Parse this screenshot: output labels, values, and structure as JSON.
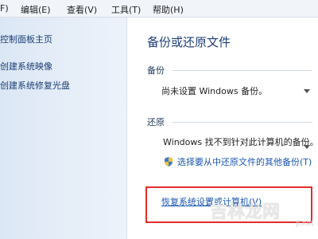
{
  "menubar": {
    "items": [
      "F)",
      "编辑(E)",
      "查看(V)",
      "工具(T)",
      "帮助(H)"
    ]
  },
  "sidebar": {
    "items": [
      "控制面板主页",
      "创建系统映像",
      "创建系统修复光盘"
    ]
  },
  "main": {
    "title": "备份或还原文件",
    "backup": {
      "heading": "备份",
      "status": "尚未设置 Windows 备份。"
    },
    "restore": {
      "heading": "还原",
      "status": "Windows 找不到针对此计算机的备份。",
      "other_link": "选择要从中还原文件的其他备份(T)",
      "recover_link": "恢复系统设置或计算机(V)"
    }
  },
  "watermark": {
    "text": "吉林龙网",
    "small": "jl.net"
  },
  "colors": {
    "highlight": "#e42c2c",
    "link": "#1a56b0",
    "sidebar_bg": "#dce7f5"
  },
  "icons": [
    "shield-icon",
    "chevron-down-icon"
  ]
}
